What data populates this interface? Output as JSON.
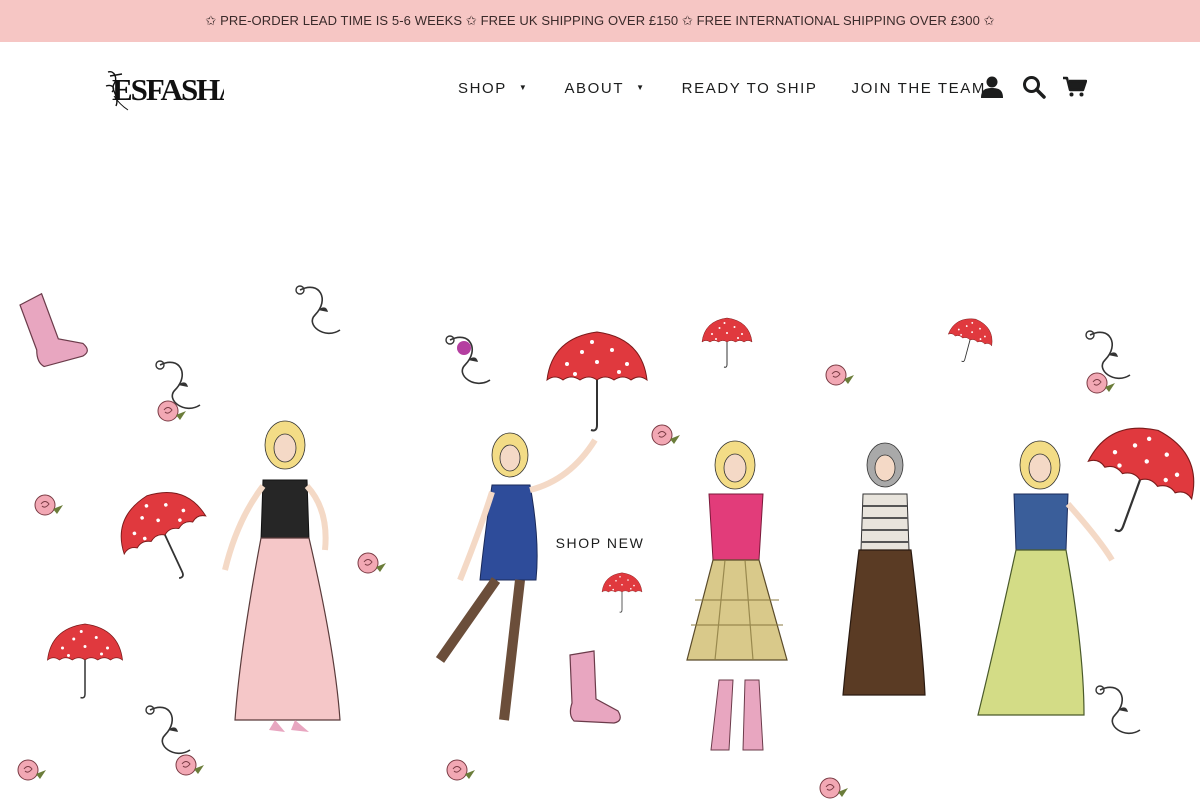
{
  "announcement": {
    "text": "✩ PRE-ORDER LEAD TIME IS 5-6 WEEKS ✩ FREE UK SHIPPING OVER £150 ✩ FREE INTERNATIONAL SHIPPING OVER £300 ✩"
  },
  "header": {
    "logo_text": "ESFASHA",
    "nav": [
      {
        "label": "SHOP",
        "has_dropdown": true
      },
      {
        "label": "ABOUT",
        "has_dropdown": true
      },
      {
        "label": "READY TO SHIP",
        "has_dropdown": false
      },
      {
        "label": "JOIN THE TEAM",
        "has_dropdown": false
      }
    ],
    "icons": [
      "account-icon",
      "search-icon",
      "cart-icon"
    ]
  },
  "hero": {
    "cta_label": "SHOP NEW"
  },
  "colors": {
    "announcement_bg": "#f6c6c4",
    "text": "#1c1d1d",
    "umbrella_red": "#e0393e",
    "boot_pink": "#e8a6c0",
    "rose_pink": "#f2a8b4"
  }
}
